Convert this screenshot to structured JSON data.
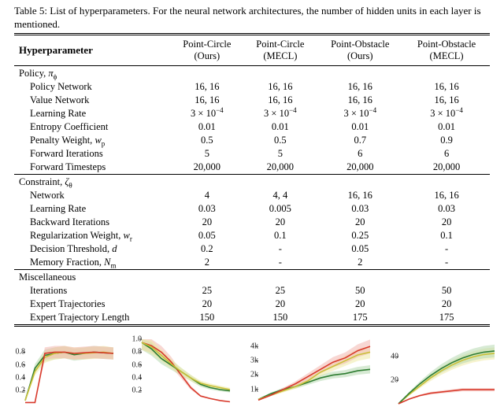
{
  "caption": "Table 5: List of hyperparameters. For the neural network architectures, the number of hidden units in each layer is mentioned.",
  "header": {
    "param": "Hyperparameter",
    "cols": [
      {
        "top": "Point-Circle",
        "bot": "(Ours)"
      },
      {
        "top": "Point-Circle",
        "bot": "(MECL)"
      },
      {
        "top": "Point-Obstacle",
        "bot": "(Ours)"
      },
      {
        "top": "Point-Obstacle",
        "bot": "(MECL)"
      }
    ]
  },
  "sections": [
    {
      "title": "Policy, π_ϕ",
      "title_html": "Policy, <i>π</i><sub>ϕ</sub>",
      "rows": [
        {
          "label": "Policy Network",
          "vals": [
            "16, 16",
            "16, 16",
            "16, 16",
            "16, 16"
          ]
        },
        {
          "label": "Value Network",
          "vals": [
            "16, 16",
            "16, 16",
            "16, 16",
            "16, 16"
          ]
        },
        {
          "label": "Learning Rate",
          "vals_html": [
            "3 × 10<sup>−4</sup>",
            "3 × 10<sup>−4</sup>",
            "3 × 10<sup>−4</sup>",
            "3 × 10<sup>−4</sup>"
          ]
        },
        {
          "label": "Entropy Coefficient",
          "vals": [
            "0.01",
            "0.01",
            "0.01",
            "0.01"
          ]
        },
        {
          "label_html": "Penalty Weight, <i>w</i><sub>p</sub>",
          "vals": [
            "0.5",
            "0.5",
            "0.7",
            "0.9"
          ]
        },
        {
          "label": "Forward Iterations",
          "vals": [
            "5",
            "5",
            "6",
            "6"
          ]
        },
        {
          "label": "Forward Timesteps",
          "vals": [
            "20,000",
            "20,000",
            "20,000",
            "20,000"
          ]
        }
      ]
    },
    {
      "title": "Constraint, ζ_θ",
      "title_html": "Constraint, <i>ζ</i><sub>θ</sub>",
      "rows": [
        {
          "label": "Network",
          "vals": [
            "4",
            "4, 4",
            "16, 16",
            "16, 16"
          ]
        },
        {
          "label": "Learning Rate",
          "vals": [
            "0.03",
            "0.005",
            "0.03",
            "0.03"
          ]
        },
        {
          "label": "Backward Iterations",
          "vals": [
            "20",
            "20",
            "20",
            "20"
          ]
        },
        {
          "label_html": "Regularization Weight, <i>w</i><sub>r</sub>",
          "vals": [
            "0.05",
            "0.1",
            "0.25",
            "0.1"
          ]
        },
        {
          "label_html": "Decision Threshold, <i>d</i>",
          "vals": [
            "0.2",
            "-",
            "0.05",
            "-"
          ]
        },
        {
          "label_html": "Memory Fraction, <i>N</i><sub>m</sub>",
          "vals": [
            "2",
            "-",
            "2",
            "-"
          ]
        }
      ]
    },
    {
      "title": "Miscellaneous",
      "rows": [
        {
          "label": "Iterations",
          "vals": [
            "25",
            "25",
            "50",
            "50"
          ]
        },
        {
          "label": "Expert Trajectories",
          "vals": [
            "20",
            "20",
            "20",
            "20"
          ]
        },
        {
          "label": "Expert Trajectory Length",
          "vals": [
            "150",
            "150",
            "175",
            "175"
          ]
        }
      ]
    }
  ],
  "chart_data": [
    {
      "type": "line",
      "ylim": [
        0,
        1.0
      ],
      "yticks": [
        "0.2",
        "0.4",
        "0.6",
        "0.8"
      ],
      "series": [
        {
          "name": "green",
          "color": "#2f7d32",
          "band": "#b7d9b0",
          "y": [
            0.05,
            0.55,
            0.75,
            0.78,
            0.8,
            0.76,
            0.78,
            0.8,
            0.79,
            0.78
          ]
        },
        {
          "name": "yellow",
          "color": "#c9c037",
          "band": "#efe9a6",
          "y": [
            0.05,
            0.5,
            0.72,
            0.78,
            0.8,
            0.78,
            0.78,
            0.79,
            0.8,
            0.78
          ]
        },
        {
          "name": "red",
          "color": "#d8392b",
          "band": "#f3b6ae",
          "y": [
            0.02,
            0.02,
            0.78,
            0.8,
            0.8,
            0.78,
            0.79,
            0.8,
            0.79,
            0.78
          ]
        }
      ]
    },
    {
      "type": "line",
      "ylim": [
        0,
        1.0
      ],
      "yticks": [
        "0.2",
        "0.4",
        "0.6",
        "0.8",
        "1.0"
      ],
      "series": [
        {
          "name": "red",
          "color": "#d8392b",
          "band": "#f3b6ae",
          "y": [
            0.95,
            0.9,
            0.8,
            0.65,
            0.45,
            0.25,
            0.12,
            0.08,
            0.05,
            0.03
          ]
        },
        {
          "name": "green",
          "color": "#2f7d32",
          "band": "#b7d9b0",
          "y": [
            0.95,
            0.85,
            0.7,
            0.6,
            0.5,
            0.4,
            0.3,
            0.25,
            0.22,
            0.2
          ]
        },
        {
          "name": "yellow",
          "color": "#c9c037",
          "band": "#efe9a6",
          "y": [
            0.95,
            0.88,
            0.75,
            0.62,
            0.5,
            0.4,
            0.32,
            0.28,
            0.25,
            0.22
          ]
        }
      ]
    },
    {
      "type": "line",
      "ylim": [
        0,
        4500
      ],
      "yticks": [
        "1k",
        "2k",
        "3k",
        "4k"
      ],
      "series": [
        {
          "name": "green",
          "color": "#2f7d32",
          "band": "#b7d9b0",
          "y": [
            300,
            700,
            1000,
            1200,
            1500,
            1800,
            2000,
            2100,
            2300,
            2400
          ]
        },
        {
          "name": "yellow",
          "color": "#c9c037",
          "band": "#efe9a6",
          "y": [
            300,
            600,
            900,
            1200,
            1600,
            2200,
            2600,
            3000,
            3400,
            3600
          ]
        },
        {
          "name": "red",
          "color": "#d8392b",
          "band": "#f3b6ae",
          "y": [
            250,
            600,
            1000,
            1400,
            1900,
            2400,
            2900,
            3200,
            3700,
            4000
          ]
        }
      ]
    },
    {
      "type": "line",
      "ylim": [
        0,
        55
      ],
      "yticks": [
        "20",
        "40"
      ],
      "series": [
        {
          "name": "yellow",
          "color": "#c9c037",
          "band": "#efe9a6",
          "y": [
            0,
            8,
            15,
            22,
            28,
            33,
            37,
            40,
            42,
            43
          ]
        },
        {
          "name": "green",
          "color": "#2f7d32",
          "band": "#b7d9b0",
          "y": [
            0,
            9,
            17,
            24,
            30,
            35,
            39,
            42,
            44,
            45
          ]
        },
        {
          "name": "red",
          "color": "#d8392b",
          "band": "#f3b6ae",
          "y": [
            0,
            4,
            7,
            9,
            10,
            11,
            12,
            12,
            12,
            12
          ]
        }
      ]
    }
  ]
}
